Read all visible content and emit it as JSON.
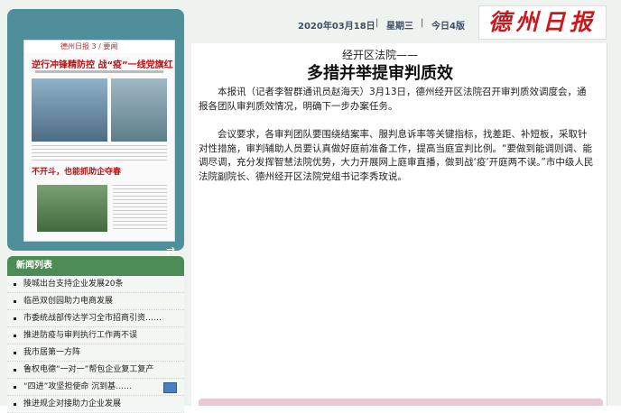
{
  "header": {
    "date": "2020年03月18日",
    "sep": "|",
    "weekday": "星期三",
    "page": "今日4版",
    "logo_text": "德州日报"
  },
  "thumbnail": {
    "masthead": "德州日报 3 / 要闻",
    "headline": "逆行冲锋精防控 战“疫”一线党旗红",
    "headline2": "不开斗，也能抓助企夺春"
  },
  "news_list": {
    "title": "新闻列表",
    "items": [
      "陵城出台支持企业发展20条",
      "临邑双创园助力电商发展",
      "市委统战部传达学习全市招商引资……",
      "推进防疫与审判执行工作两不误",
      "我市居第一方阵",
      "鲁权电德“一对一”帮包企业复工复产",
      "“四进”攻坚担使命 沉到基……",
      "推进规企对接助力企业发展"
    ]
  },
  "article": {
    "kicker": "经开区法院——",
    "title": "多措并举提审判质效",
    "paragraphs": [
      "本报讯（记者李智群通讯员赵海天）3月13日，德州经开区法院召开审判质效调度会，通报各团队审判质效情况，明确下一步办案任务。",
      "会议要求，各审判团队要围绕结案率、服判息诉率等关键指标，找差距、补短板，采取针对性措施，审判辅助人员要认真做好庭前准备工作，提高当庭宣判比例。“要做到能调则调、能调尽调，充分发挥智慧法院优势，大力开展网上庭审直播，做到战‘疫’开庭两不误。”市中级人民法院副院长、德州经开区法院党组书记李秀玫说。"
    ]
  }
}
